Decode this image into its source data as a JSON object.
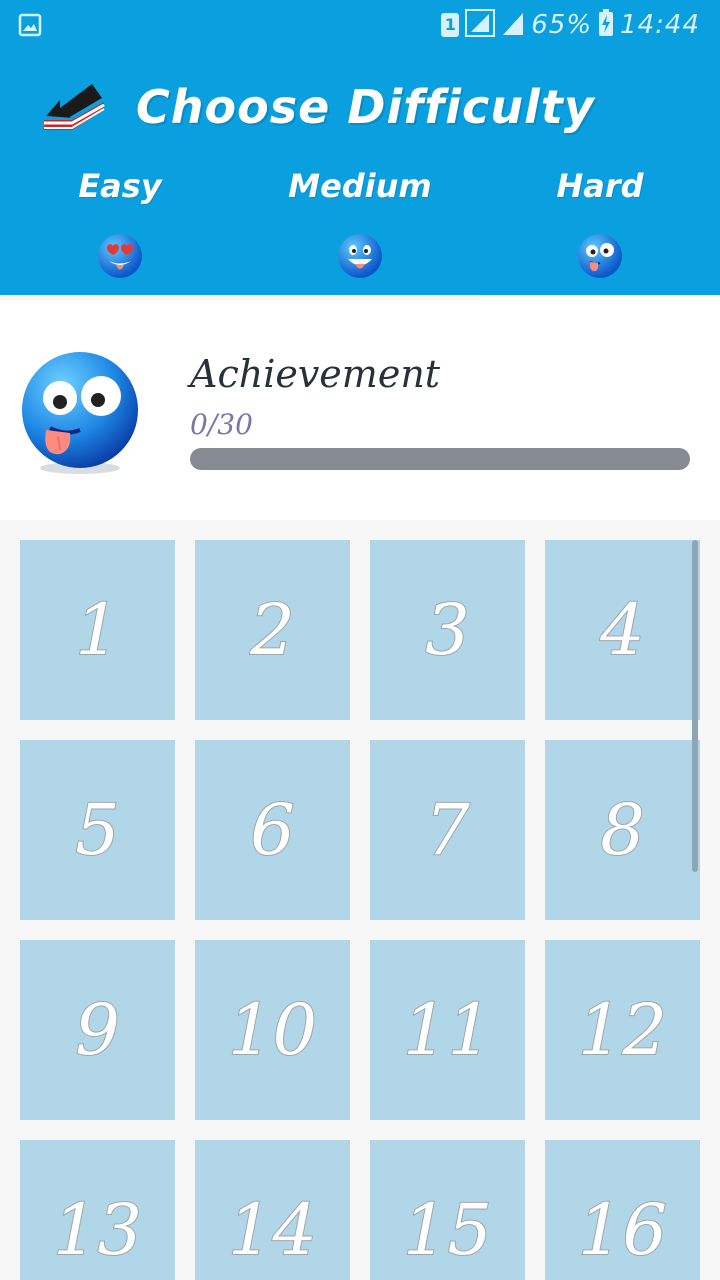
{
  "status_bar": {
    "sim_slot": "1",
    "battery_percent": "65%",
    "time": "14:44",
    "icons": [
      "image-icon",
      "sim-icon",
      "signal-icon",
      "signal-icon",
      "battery-charging-icon"
    ]
  },
  "header": {
    "title": "Choose Difficulty",
    "back_icon": "back-arrow-icon",
    "background_color": "#0aa0e0"
  },
  "tabs": [
    {
      "label": "Easy",
      "icon": "heart-eyes-face-icon",
      "selected": false
    },
    {
      "label": "Medium",
      "icon": "grinning-face-icon",
      "selected": false
    },
    {
      "label": "Hard",
      "icon": "silly-face-icon",
      "selected": true
    }
  ],
  "achievement": {
    "title": "Achievement",
    "count_text": "0/30",
    "progress_fraction": 0,
    "icon": "silly-face-icon"
  },
  "levels": [
    "1",
    "2",
    "3",
    "4",
    "5",
    "6",
    "7",
    "8",
    "9",
    "10",
    "11",
    "12",
    "13",
    "14",
    "15",
    "16"
  ],
  "colors": {
    "accent": "#0aa0e0",
    "tile": "#b0d6e8",
    "progress_track": "#868b93"
  }
}
